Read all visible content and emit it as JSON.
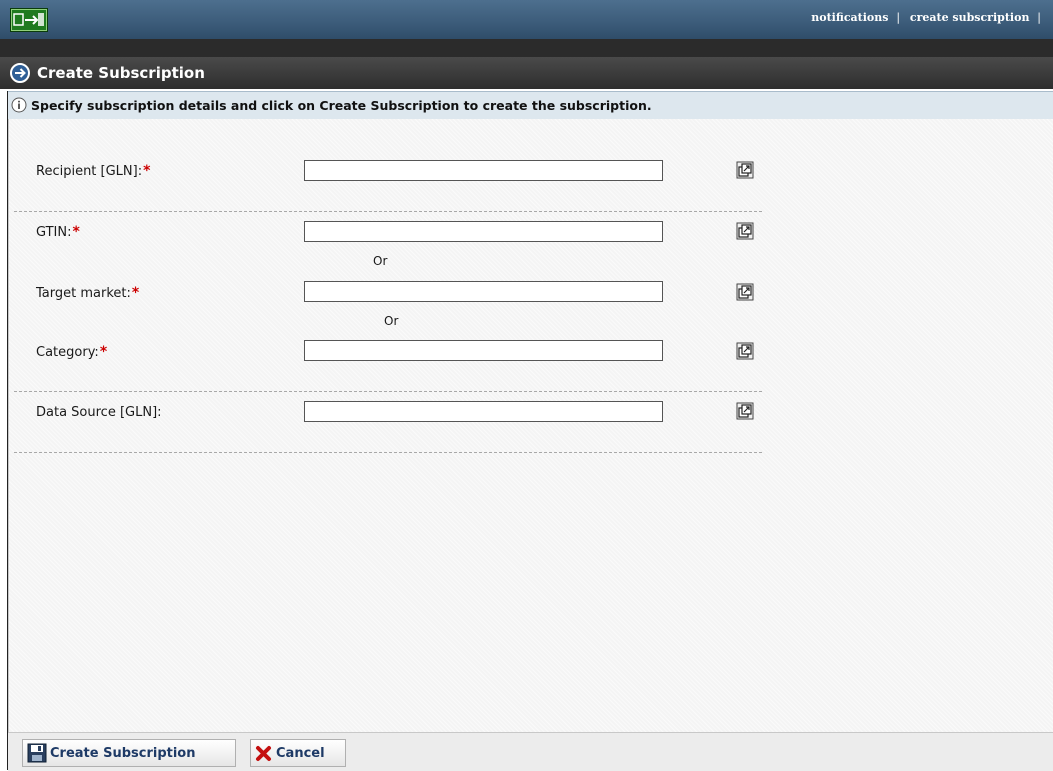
{
  "header": {
    "links": [
      {
        "label": "notifications"
      },
      {
        "label": "create subscription"
      }
    ],
    "separator": "|"
  },
  "page": {
    "title": "Create Subscription",
    "info": "Specify subscription details and click on Create Subscription to create the subscription."
  },
  "form": {
    "recipient_label": "Recipient [GLN]:",
    "gtin_label": "GTIN:",
    "target_market_label": "Target market:",
    "category_label": "Category:",
    "data_source_label": "Data Source [GLN]:",
    "required_marker": "*",
    "or_text": "Or",
    "recipient_value": "",
    "gtin_value": "",
    "target_market_value": "",
    "category_value": "",
    "data_source_value": ""
  },
  "footer": {
    "create_label": "Create Subscription",
    "cancel_label": "Cancel"
  },
  "icons": {
    "logo": "app-logo-icon",
    "title": "arrow-circle-right-icon",
    "info": "info-icon",
    "lookup": "lookup-popup-icon",
    "save": "save-icon",
    "cancel": "cancel-x-icon"
  },
  "colors": {
    "topbar": "#3d5d7b",
    "titlebar": "#2e2e2e",
    "infobar": "#dde7ee",
    "required": "#cc0000",
    "button_text": "#1e3a66"
  }
}
